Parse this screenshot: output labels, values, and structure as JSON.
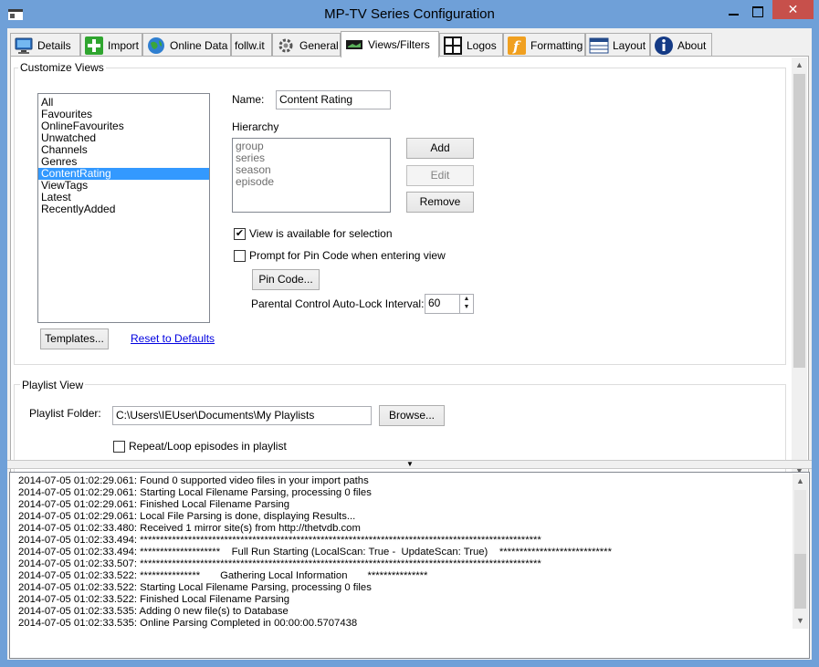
{
  "window": {
    "title": "MP-TV Series Configuration",
    "close_glyph": "✕"
  },
  "tabs": [
    {
      "label": "Details",
      "icon": "monitor-icon"
    },
    {
      "label": "Import",
      "icon": "plus-icon"
    },
    {
      "label": "Online Data",
      "icon": "globe-icon"
    },
    {
      "label": "follw.it",
      "icon": ""
    },
    {
      "label": "General",
      "icon": "gear-icon"
    },
    {
      "label": "Views/Filters",
      "icon": "screen-icon",
      "active": true
    },
    {
      "label": "Logos",
      "icon": "grid-icon"
    },
    {
      "label": "Formatting",
      "icon": "function-icon"
    },
    {
      "label": "Layout",
      "icon": "table-icon"
    },
    {
      "label": "About",
      "icon": "info-icon"
    }
  ],
  "customize_views": {
    "group_label": "Customize Views",
    "views": [
      "All",
      "Favourites",
      "OnlineFavourites",
      "Unwatched",
      "Channels",
      "Genres",
      "ContentRating",
      "ViewTags",
      "Latest",
      "RecentlyAdded"
    ],
    "selected_view": "ContentRating",
    "name_label": "Name:",
    "name_value": "Content Rating",
    "hierarchy_label": "Hierarchy",
    "hierarchy_items": [
      "group",
      "series",
      "season",
      "episode"
    ],
    "add_label": "Add",
    "edit_label": "Edit",
    "remove_label": "Remove",
    "available_label": "View is available for selection",
    "available_checked": true,
    "pin_prompt_label": "Prompt for Pin Code when entering view",
    "pin_prompt_checked": false,
    "pin_code_label": "Pin Code...",
    "autolock_label": "Parental Control Auto-Lock Interval:",
    "autolock_value": "60",
    "templates_label": "Templates...",
    "reset_label": "Reset to Defaults"
  },
  "playlist_view": {
    "group_label": "Playlist View",
    "folder_label": "Playlist Folder:",
    "folder_value": "C:\\Users\\IEUser\\Documents\\My Playlists",
    "browse_label": "Browse...",
    "repeat_label": "Repeat/Loop episodes in playlist",
    "repeat_checked": false
  },
  "log": [
    "2014-07-05 01:02:29.061: Found 0 supported video files in your import paths",
    "2014-07-05 01:02:29.061: Starting Local Filename Parsing, processing 0 files",
    "2014-07-05 01:02:29.061: Finished Local Filename Parsing",
    "2014-07-05 01:02:29.061: Local File Parsing is done, displaying Results...",
    "2014-07-05 01:02:33.480: Received 1 mirror site(s) from http://thetvdb.com",
    "2014-07-05 01:02:33.494: ****************************************************************************************************",
    "2014-07-05 01:02:33.494: ********************    Full Run Starting (LocalScan: True -  UpdateScan: True)    ****************************",
    "2014-07-05 01:02:33.507: ****************************************************************************************************",
    "2014-07-05 01:02:33.522: ***************       Gathering Local Information       ***************",
    "2014-07-05 01:02:33.522: Starting Local Filename Parsing, processing 0 files",
    "2014-07-05 01:02:33.522: Finished Local Filename Parsing",
    "2014-07-05 01:02:33.535: Adding 0 new file(s) to Database",
    "2014-07-05 01:02:33.535: Online Parsing Completed in 00:00:00.5707438"
  ]
}
